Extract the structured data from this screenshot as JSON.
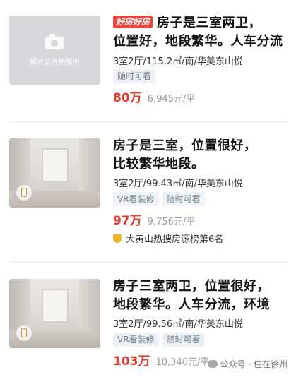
{
  "listings": [
    {
      "hot_badge": "好房好房",
      "photo_caption": "照片正在拍摄中",
      "title_line1": "房子是三室两卫，",
      "title_line2": "位置好，地段繁华。人车分流",
      "meta": "3室2厅/115.2㎡/南/华美东山悦",
      "tags": [
        "随时可看"
      ],
      "price_total": "80万",
      "price_unit": "6,945元/平"
    },
    {
      "title_line1": "房子是三室，位置很好，",
      "title_line2": "比较繁华地段。",
      "meta": "3室2厅/99.43㎡/南/华美东山悦",
      "tags": [
        "VR看装修",
        "随时可看"
      ],
      "price_total": "97万",
      "price_unit": "9,756元/平",
      "rank": "大黄山热搜房源榜第6名"
    },
    {
      "title_line1": "房子三室两卫，位置很好，",
      "title_line2": "地段繁华。人车分流，环境",
      "meta": "3室2厅/99.56㎡/南/华美东山悦",
      "tags": [
        "VR看装修",
        "随时可看"
      ],
      "price_total": "103万",
      "price_unit": "10,346元/平"
    }
  ],
  "watermark": "公众号 · 住在徐州"
}
